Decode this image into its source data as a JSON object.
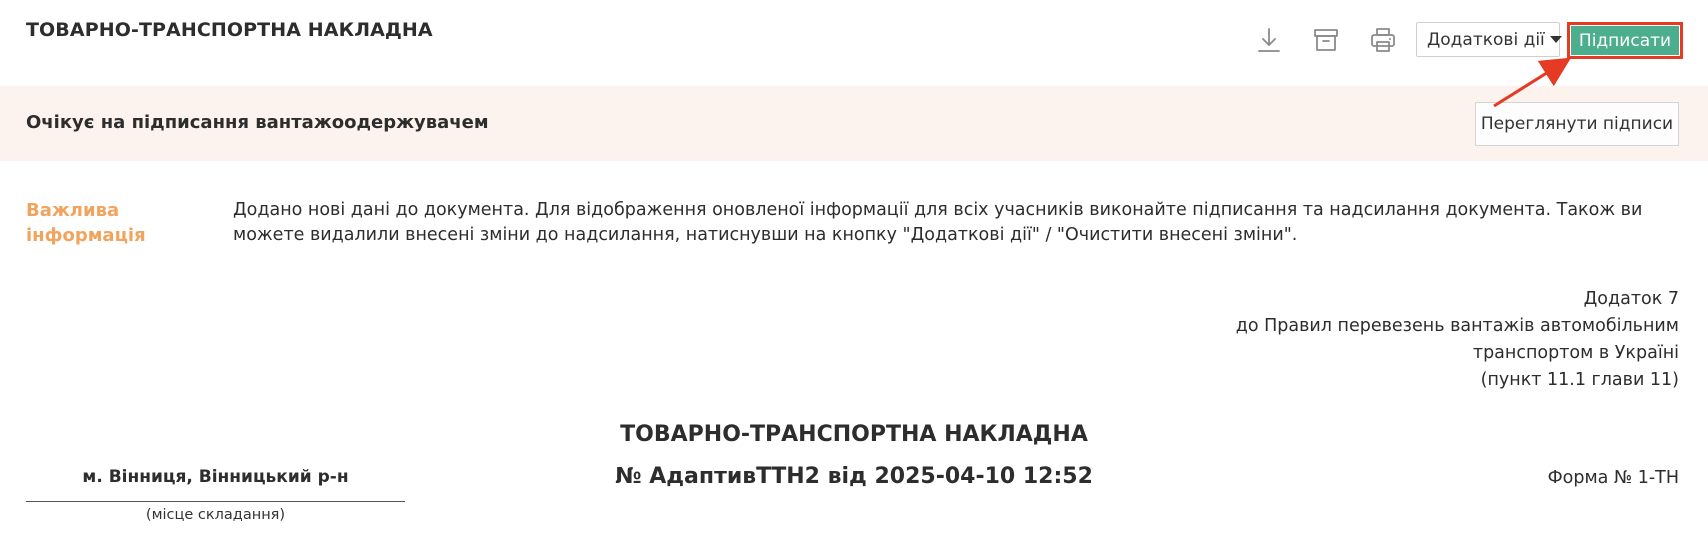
{
  "header": {
    "title": "ТОВАРНО-ТРАНСПОРТНА НАКЛАДНА",
    "icons": [
      "download-icon",
      "archive-icon",
      "print-icon"
    ],
    "more_actions_label": "Додаткові дії",
    "sign_label": "Підписати"
  },
  "status": {
    "text": "Очікує на підписання вантажоодержувачем",
    "view_signatures_label": "Переглянути підписи"
  },
  "notice": {
    "label_line1": "Важлива",
    "label_line2": "інформація",
    "text": "Додано нові дані до документа. Для відображення оновленої інформації для всіх учасників виконайте підписання та надсилання документа. Також ви можете видалили внесені зміни до надсилання, натиснувши на кнопку \"Додаткові дії\" / \"Очистити внесені зміни\"."
  },
  "appendix": {
    "line1": "Додаток 7",
    "line2": "до Правил перевезень вантажів автомобільним",
    "line3": "транспортом в Україні",
    "line4": "(пункт 11.1 глави 11)"
  },
  "document": {
    "title": "ТОВАРНО-ТРАНСПОРТНА НАКЛАДНА",
    "number_line": "№ АдаптивТТН2 від 2025-04-10 12:52",
    "place": "м. Вінниця, Вінницький р-н",
    "place_caption": "(місце складання)",
    "form_number": "Форма № 1-ТН"
  },
  "colors": {
    "accent_green": "#4cae8c",
    "highlight_red": "#e53b25",
    "status_bg": "#fdf3ee",
    "notice_label": "#f0a45e"
  }
}
